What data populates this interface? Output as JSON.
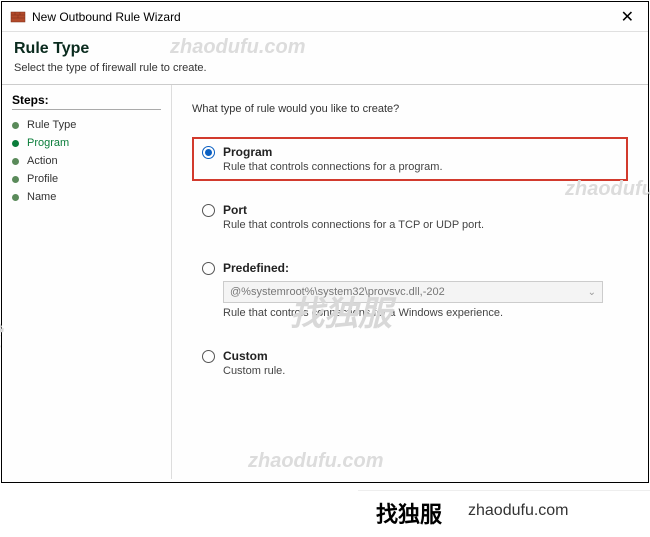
{
  "window": {
    "title": "New Outbound Rule Wizard"
  },
  "header": {
    "title": "Rule Type",
    "subtitle": "Select the type of firewall rule to create."
  },
  "sidebar": {
    "label": "Steps:",
    "items": [
      {
        "label": "Rule Type"
      },
      {
        "label": "Program"
      },
      {
        "label": "Action"
      },
      {
        "label": "Profile"
      },
      {
        "label": "Name"
      }
    ]
  },
  "content": {
    "prompt": "What type of rule would you like to create?",
    "options": {
      "program": {
        "label": "Program",
        "desc": "Rule that controls connections for a program."
      },
      "port": {
        "label": "Port",
        "desc": "Rule that controls connections for a TCP or UDP port."
      },
      "predefined": {
        "label": "Predefined:",
        "dropdown": "@%systemroot%\\system32\\provsvc.dll,-202",
        "desc": "Rule that controls connections for a Windows experience."
      },
      "custom": {
        "label": "Custom",
        "desc": "Custom rule."
      }
    }
  },
  "watermarks": {
    "w1": "zhaodufu.com",
    "w2": "zhaodufu",
    "w3": "找独服",
    "w4": "zhaodufu.com",
    "w5": "找"
  },
  "footer": {
    "cn": "找独服",
    "en": "zhaodufu.com"
  }
}
